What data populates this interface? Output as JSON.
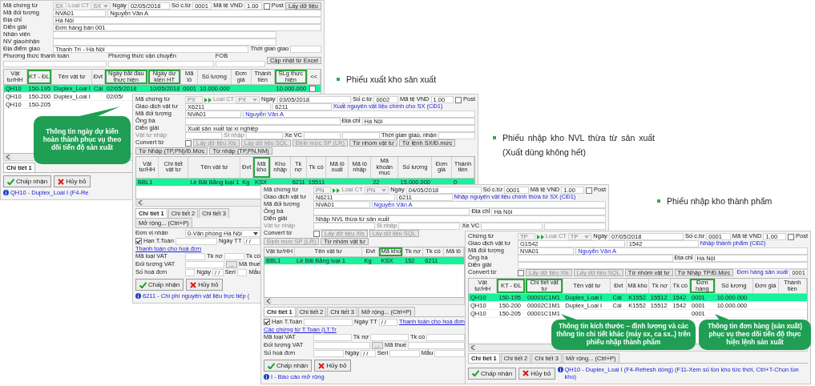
{
  "windows": [
    {
      "form": [
        [
          {
            "kind": "label",
            "text": "Mã chứng từ",
            "disabled": false
          },
          {
            "kind": "field",
            "value": "SX",
            "disabled": true
          },
          {
            "kind": "label",
            "text": "Loại CT",
            "disabled": true
          },
          {
            "kind": "combo",
            "value": "SX",
            "disabled": true
          },
          {
            "kind": "label",
            "text": "Ngày",
            "disabled": false
          },
          {
            "kind": "field",
            "value": "02/05/2018",
            "disabled": false
          },
          {
            "kind": "label",
            "text": "Số c.từ",
            "disabled": false
          },
          {
            "kind": "field",
            "value": "0001",
            "disabled": false
          },
          {
            "kind": "label",
            "text": "Mã tệ",
            "disabled": false
          },
          {
            "kind": "label",
            "text": "VND",
            "disabled": false
          },
          {
            "kind": "field",
            "value": "1.00",
            "disabled": false
          },
          {
            "kind": "check",
            "label": "Post",
            "checked": false
          },
          {
            "kind": "button",
            "label": "Lấy dữ liệu",
            "disabled": false
          }
        ],
        [
          {
            "kind": "label",
            "text": "Mã đối tượng",
            "disabled": false
          },
          {
            "kind": "field",
            "value": "NVA01",
            "disabled": false
          },
          {
            "kind": "field",
            "value": "Nguyễn Văn A",
            "disabled": false
          }
        ],
        [
          {
            "kind": "label",
            "text": "Địa chỉ",
            "disabled": false
          },
          {
            "kind": "field",
            "value": "Hà Nội",
            "disabled": false
          }
        ],
        [
          {
            "kind": "label",
            "text": "Diễn giải",
            "disabled": false
          },
          {
            "kind": "field",
            "value": "Đơn hàng bán 001",
            "disabled": false
          }
        ],
        [
          {
            "kind": "label",
            "text": "Nhân viên",
            "disabled": false
          },
          {
            "kind": "field",
            "disabled": false
          },
          {
            "kind": "spacer"
          }
        ],
        [
          {
            "kind": "label",
            "text": "NV giao/nhận",
            "disabled": false
          },
          {
            "kind": "field",
            "disabled": false
          },
          {
            "kind": "spacer"
          }
        ],
        [
          {
            "kind": "label",
            "text": "Địa điểm giao",
            "disabled": false
          },
          {
            "kind": "field",
            "value": "Thanh Trì - Hà Nội",
            "disabled": false
          },
          {
            "kind": "label",
            "text": "Thời gian giao",
            "disabled": false
          },
          {
            "kind": "field",
            "disabled": false
          }
        ],
        [
          {
            "kind": "titled",
            "label": "Phương thức thanh toán"
          },
          {
            "kind": "titled",
            "label": "Phương thức vận chuyển"
          },
          {
            "kind": "titled",
            "label": "FOB"
          },
          {
            "kind": "button",
            "label": "Cập nhật từ Excel",
            "disabled": false
          }
        ]
      ],
      "grid": {
        "columns": [
          {
            "label": "Vật tư/HH",
            "highlight": false
          },
          {
            "label": "KT - ĐL",
            "highlight": true
          },
          {
            "label": "Tên vật tư",
            "highlight": false
          },
          {
            "label": "Đvt",
            "highlight": false
          },
          {
            "label": "Ngày bắt đầu thực hiện",
            "highlight": true
          },
          {
            "label": "Ngày dự kiến HT",
            "highlight": true
          },
          {
            "label": "Mã lô",
            "highlight": false
          },
          {
            "label": "Số lượng",
            "highlight": false
          },
          {
            "label": "Đơn giá",
            "highlight": false
          },
          {
            "label": "Thành tiền",
            "highlight": false
          },
          {
            "label": "SLg thực hiện",
            "highlight": true
          },
          {
            "label": "<<",
            "highlight": false
          }
        ],
        "rows": [
          {
            "selected": true,
            "cells": [
              "QH10",
              "150-195",
              "Duplex_Loai I",
              "Cái",
              "02/05/2018",
              "10/05/2018",
              "0001",
              "10.000.000",
              null,
              null,
              "10.000.000",
              {
                "checked": false
              }
            ]
          },
          {
            "selected": false,
            "cells": [
              "QH10",
              "150-200",
              "Duplex_Loai I",
              null,
              "02/05/"
            ]
          },
          {
            "selected": false,
            "cells": [
              "QH10",
              "150-205"
            ]
          }
        ]
      },
      "tabs": [
        {
          "label": "Chi tiết 1",
          "selected": true
        }
      ],
      "actions": [
        {
          "kind": "accept",
          "label": "Chấp nhận"
        },
        {
          "kind": "cancel",
          "label": "Hủy bỏ"
        }
      ],
      "status": "QH10 - Duplex_Loai I (F4-Re"
    },
    {
      "form": [
        [
          {
            "kind": "label",
            "text": "Mã chứng từ",
            "disabled": false
          },
          {
            "kind": "field",
            "value": "PX",
            "disabled": true
          },
          {
            "kind": "jump"
          },
          {
            "kind": "label",
            "text": "Loại CT",
            "disabled": true
          },
          {
            "kind": "combo",
            "value": "PX",
            "disabled": true
          },
          {
            "kind": "label",
            "text": "Ngày",
            "disabled": false
          },
          {
            "kind": "field",
            "value": "03/05/2018",
            "disabled": false
          },
          {
            "kind": "label",
            "text": "Số c.từ",
            "disabled": false
          },
          {
            "kind": "field",
            "value": "0002",
            "disabled": false
          },
          {
            "kind": "label",
            "text": "Mã tệ",
            "disabled": false
          },
          {
            "kind": "label",
            "text": "VND",
            "disabled": false
          },
          {
            "kind": "field",
            "value": "1.00",
            "disabled": false
          },
          {
            "kind": "check",
            "label": "Post",
            "checked": false
          }
        ],
        [
          {
            "kind": "label",
            "text": "Giao dịch vật tư",
            "disabled": false
          },
          {
            "kind": "field",
            "value": "X6211",
            "disabled": false
          },
          {
            "kind": "field",
            "value": "6211",
            "disabled": false
          },
          {
            "kind": "link",
            "text": "Xuất nguyên vật liệu chính cho SX (CĐ1)"
          },
          {
            "kind": "spacer"
          }
        ],
        [
          {
            "kind": "label",
            "text": "Mã đối tượng",
            "disabled": false
          },
          {
            "kind": "field",
            "value": "NVA01",
            "disabled": false
          },
          {
            "kind": "name",
            "value": "Nguyễn Văn A"
          }
        ],
        [
          {
            "kind": "label",
            "text": "Ông bà",
            "disabled": false
          },
          {
            "kind": "field",
            "disabled": false
          },
          {
            "kind": "label",
            "text": "Địa chỉ",
            "disabled": false
          },
          {
            "kind": "field",
            "value": "Hà Nội",
            "disabled": false
          }
        ],
        [
          {
            "kind": "label",
            "text": "Diễn giải",
            "disabled": false
          },
          {
            "kind": "field",
            "value": "Xuất sản xuất tại xí nghiệp",
            "disabled": false
          }
        ],
        [
          {
            "kind": "label",
            "text": "Vật tư nhập",
            "disabled": true
          },
          {
            "kind": "field",
            "disabled": false
          },
          {
            "kind": "label",
            "text": "Sl nhập",
            "disabled": true
          },
          {
            "kind": "field",
            "disabled": false
          },
          {
            "kind": "label",
            "text": "Xe VC",
            "disabled": false
          },
          {
            "kind": "field",
            "disabled": false
          },
          {
            "kind": "field",
            "disabled": false
          },
          {
            "kind": "label",
            "text": "Thời gian giao, nhận",
            "disabled": false
          },
          {
            "kind": "field",
            "disabled": false
          }
        ],
        [
          {
            "kind": "label",
            "text": "Convert từ",
            "disabled": false
          },
          {
            "kind": "check",
            "checked": false
          },
          {
            "kind": "button",
            "label": "Lấy dữ liệu Xls",
            "disabled": true
          },
          {
            "kind": "button",
            "label": "Lấy dữ liệu SQL",
            "disabled": true
          },
          {
            "kind": "button",
            "label": "Định mức SP (LR)",
            "disabled": true
          },
          {
            "kind": "button",
            "label": "Từ nhóm vật tư",
            "disabled": false
          },
          {
            "kind": "button",
            "label": "Từ lệnh SX/Đ.mức",
            "disabled": false
          },
          {
            "kind": "button",
            "label": "Từ Nhập (TP,PN)/Đ.Mức",
            "disabled": false
          },
          {
            "kind": "button",
            "label": "Từ nhập (TP,PN,NM)",
            "disabled": false
          }
        ]
      ],
      "grid": {
        "columns": [
          {
            "label": "Vật tư/HH",
            "highlight": false
          },
          {
            "label": "Chi tiết vật tư",
            "highlight": false
          },
          {
            "label": "Tên vật tư",
            "highlight": false
          },
          {
            "label": "Đvt",
            "highlight": false
          },
          {
            "label": "Mã kho",
            "highlight": true
          },
          {
            "label": "Kho nhập",
            "highlight": false
          },
          {
            "label": "Tk nợ",
            "highlight": false
          },
          {
            "label": "Tk có",
            "highlight": false
          },
          {
            "label": "Mã lô xuất",
            "highlight": false
          },
          {
            "label": "Mã lô nhập",
            "highlight": false
          },
          {
            "label": "Mã khoản mục",
            "highlight": false
          },
          {
            "label": "Số lượng",
            "highlight": false
          },
          {
            "label": "Đơn giá",
            "highlight": false
          },
          {
            "label": "Thành tiền",
            "highlight": false
          }
        ],
        "rows": [
          {
            "selected": true,
            "cells": [
              "BBL1",
              null,
              "Lề Bãi Bằng loại 1",
              "Kg",
              "KSX",
              null,
              "6211",
              "15511",
              null,
              null,
              "22",
              "15.000.000",
              null,
              "0"
            ]
          }
        ]
      },
      "tabs": [
        {
          "label": "Chi tiết 1",
          "selected": true
        },
        {
          "label": "Chi tiết 2",
          "selected": false
        },
        {
          "label": "Chi tiết 3",
          "selected": false
        },
        {
          "label": "Mở rộng... (Ctrl+P)",
          "selected": false
        }
      ],
      "details": [
        [
          {
            "kind": "label",
            "text": "Đơn vị nhận",
            "disabled": false
          },
          {
            "kind": "combo",
            "value": "0-Văn phòng Hà Nội",
            "disabled": false
          }
        ],
        [
          {
            "kind": "check",
            "label": "Hạn T.Toán",
            "checked": true
          },
          {
            "kind": "field",
            "disabled": false
          },
          {
            "kind": "label",
            "text": "Ngày TT",
            "disabled": false
          },
          {
            "kind": "field",
            "value": "/ /",
            "disabled": false
          },
          {
            "kind": "link",
            "text": "Thanh toán cho hoá đơn"
          }
        ],
        [
          {
            "kind": "label",
            "text": "Mã loại VAT",
            "disabled": false
          },
          {
            "kind": "field",
            "disabled": false
          },
          {
            "kind": "label",
            "text": "Tk nợ",
            "disabled": false
          },
          {
            "kind": "field",
            "disabled": false
          },
          {
            "kind": "label",
            "text": "Tk có",
            "disabled": false
          }
        ],
        [
          {
            "kind": "label",
            "text": "Đối tượng VAT",
            "disabled": false
          },
          {
            "kind": "field",
            "disabled": false
          },
          {
            "kind": "button",
            "label": "...",
            "disabled": false
          },
          {
            "kind": "label",
            "text": "Mã thuế",
            "disabled": false
          }
        ],
        [
          {
            "kind": "label",
            "text": "Số hoá đơn",
            "disabled": false
          },
          {
            "kind": "field",
            "disabled": false
          },
          {
            "kind": "label",
            "text": "Ngày",
            "disabled": false
          },
          {
            "kind": "field",
            "value": "/ /",
            "disabled": false
          },
          {
            "kind": "label",
            "text": "Seri",
            "disabled": false
          },
          {
            "kind": "field",
            "disabled": false
          },
          {
            "kind": "label",
            "text": "Mẫu",
            "disabled": false
          }
        ]
      ],
      "actions": [
        {
          "kind": "accept",
          "label": "Chấp nhận"
        },
        {
          "kind": "cancel",
          "label": "Hủy bỏ"
        }
      ],
      "status": "6211 - Chi phí nguyên vật liệu trực tiếp ("
    },
    {
      "form": [
        [
          {
            "kind": "label",
            "text": "Mã chứng từ",
            "disabled": false
          },
          {
            "kind": "field",
            "value": "PN",
            "disabled": true
          },
          {
            "kind": "jump"
          },
          {
            "kind": "label",
            "text": "Loại CT",
            "disabled": true
          },
          {
            "kind": "combo",
            "value": "PN",
            "disabled": true
          },
          {
            "kind": "label",
            "text": "Ngày",
            "disabled": false
          },
          {
            "kind": "field",
            "value": "04/05/2018",
            "disabled": false
          },
          {
            "kind": "label",
            "text": "Số c.từ",
            "disabled": false
          },
          {
            "kind": "field",
            "value": "0001",
            "disabled": false
          },
          {
            "kind": "label",
            "text": "Mã tệ",
            "disabled": false
          },
          {
            "kind": "label",
            "text": "VND",
            "disabled": false
          },
          {
            "kind": "field",
            "value": "1.00",
            "disabled": false
          },
          {
            "kind": "check",
            "label": "Post",
            "checked": false
          }
        ],
        [
          {
            "kind": "label",
            "text": "Giao dịch vật tư",
            "disabled": false
          },
          {
            "kind": "field",
            "value": "N6211",
            "disabled": false
          },
          {
            "kind": "field",
            "value": "6211",
            "disabled": false
          },
          {
            "kind": "link",
            "text": "Nhập nguyên vật liệu chính thừa từ SX (CĐ1)"
          },
          {
            "kind": "spacer"
          }
        ],
        [
          {
            "kind": "label",
            "text": "Mã đối tượng",
            "disabled": false
          },
          {
            "kind": "field",
            "value": "NVA01",
            "disabled": false
          },
          {
            "kind": "name",
            "value": "Nguyễn Văn A"
          }
        ],
        [
          {
            "kind": "label",
            "text": "Ông bà",
            "disabled": false
          },
          {
            "kind": "field",
            "disabled": false
          },
          {
            "kind": "label",
            "text": "Địa chỉ",
            "disabled": false
          },
          {
            "kind": "field",
            "value": "Hà Nội",
            "disabled": false
          }
        ],
        [
          {
            "kind": "label",
            "text": "Diễn giải",
            "disabled": false
          },
          {
            "kind": "field",
            "value": "Nhập NVL thừa từ sản xuất",
            "disabled": false
          }
        ],
        [
          {
            "kind": "label",
            "text": "Vật tư nhập",
            "disabled": true
          },
          {
            "kind": "field",
            "disabled": false
          },
          {
            "kind": "label",
            "text": "Sl nhập",
            "disabled": true
          },
          {
            "kind": "field",
            "disabled": false
          },
          {
            "kind": "label",
            "text": "Xe VC",
            "disabled": false
          },
          {
            "kind": "field",
            "disabled": false
          },
          {
            "kind": "field",
            "disabled": false
          }
        ],
        [
          {
            "kind": "label",
            "text": "Convert từ",
            "disabled": false
          },
          {
            "kind": "check",
            "checked": false
          },
          {
            "kind": "button",
            "label": "Lấy dữ liệu Xls",
            "disabled": true
          },
          {
            "kind": "button",
            "label": "Lấy dữ liệu SQL",
            "disabled": true
          },
          {
            "kind": "button",
            "label": "Định mức SP (LR)",
            "disabled": true
          },
          {
            "kind": "button",
            "label": "Từ nhóm vật tư",
            "disabled": false
          }
        ]
      ],
      "grid": {
        "columns": [
          {
            "label": "Vật tư/HH",
            "highlight": false
          },
          {
            "label": "Tên vật tư",
            "highlight": false
          },
          {
            "label": "Đvt",
            "highlight": false
          },
          {
            "label": "Mã kho",
            "highlight": true
          },
          {
            "label": "Tk nợ",
            "highlight": false
          },
          {
            "label": "Tk có",
            "highlight": false
          },
          {
            "label": "Mã lô",
            "highlight": false
          }
        ],
        "rows": [
          {
            "selected": true,
            "cells": [
              "BBL1",
              "Lề Bãi Bằng loại 1",
              "Kg",
              "KSX",
              "152",
              "6211",
              null
            ]
          }
        ]
      },
      "tabs": [
        {
          "label": "Chi tiết 1",
          "selected": true
        },
        {
          "label": "Chi tiết 2",
          "selected": false
        },
        {
          "label": "Chi tiết 3",
          "selected": false
        },
        {
          "label": "Mở rộng... (Ctrl+P)",
          "selected": false
        }
      ],
      "details": [
        [
          {
            "kind": "check",
            "label": "Hạn T.Toán",
            "checked": true
          },
          {
            "kind": "field",
            "disabled": false
          },
          {
            "kind": "label",
            "text": "Ngày TT",
            "disabled": false
          },
          {
            "kind": "field",
            "value": "/ /",
            "disabled": false
          },
          {
            "kind": "link",
            "text": "Thanh toán cho hoá đơn"
          },
          {
            "kind": "link",
            "text": "Các chứng từ T.Toán (LT.Tr"
          }
        ],
        [
          {
            "kind": "label",
            "text": "Mã loại VAT",
            "disabled": false
          },
          {
            "kind": "field",
            "disabled": false
          },
          {
            "kind": "label",
            "text": "Tk nợ",
            "disabled": false
          },
          {
            "kind": "field",
            "disabled": false
          },
          {
            "kind": "label",
            "text": "Tk có",
            "disabled": false
          },
          {
            "kind": "field",
            "disabled": false
          }
        ],
        [
          {
            "kind": "label",
            "text": "Đối tượng VAT",
            "disabled": false
          },
          {
            "kind": "field",
            "disabled": false
          },
          {
            "kind": "button",
            "label": "...",
            "disabled": false
          },
          {
            "kind": "label",
            "text": "Mã thuế",
            "disabled": false
          },
          {
            "kind": "field",
            "disabled": false
          }
        ],
        [
          {
            "kind": "label",
            "text": "Số hoá đơn",
            "disabled": false
          },
          {
            "kind": "field",
            "disabled": false
          },
          {
            "kind": "label",
            "text": "Ngày",
            "disabled": false
          },
          {
            "kind": "field",
            "value": "/ /",
            "disabled": false
          },
          {
            "kind": "label",
            "text": "Seri",
            "disabled": false
          },
          {
            "kind": "field",
            "disabled": false
          },
          {
            "kind": "label",
            "text": "Mẫu",
            "disabled": false
          },
          {
            "kind": "field",
            "disabled": false
          }
        ]
      ],
      "actions": [
        {
          "kind": "accept",
          "label": "Chấp nhận"
        },
        {
          "kind": "cancel",
          "label": "Hủy bỏ"
        }
      ],
      "status": "I - Báo cáo mở rộng"
    },
    {
      "form": [
        [
          {
            "kind": "label",
            "text": "Chứng từ",
            "disabled": false
          },
          {
            "kind": "field",
            "value": "TP",
            "disabled": true
          },
          {
            "kind": "jump"
          },
          {
            "kind": "label",
            "text": "Loại CT",
            "disabled": true
          },
          {
            "kind": "combo",
            "value": "TP",
            "disabled": true
          },
          {
            "kind": "label",
            "text": "Ngày",
            "disabled": false
          },
          {
            "kind": "field",
            "value": "07/05/2018",
            "disabled": false
          },
          {
            "kind": "label",
            "text": "Số c.từ",
            "disabled": false
          },
          {
            "kind": "field",
            "value": "0001",
            "disabled": false
          },
          {
            "kind": "label",
            "text": "Mã tệ",
            "disabled": false
          },
          {
            "kind": "label",
            "text": "VND",
            "disabled": false
          },
          {
            "kind": "field",
            "value": "1.00",
            "disabled": false
          },
          {
            "kind": "check",
            "label": "Post",
            "checked": false
          }
        ],
        [
          {
            "kind": "label",
            "text": "Giao dịch vật tư",
            "disabled": false
          },
          {
            "kind": "field",
            "value": "G1542",
            "disabled": false
          },
          {
            "kind": "field",
            "value": "1542",
            "disabled": false
          },
          {
            "kind": "link",
            "text": "Nhập thành phẩm (CĐ2)"
          },
          {
            "kind": "spacer"
          }
        ],
        [
          {
            "kind": "label",
            "text": "Mã đối tượng",
            "disabled": false
          },
          {
            "kind": "field",
            "value": "NVA01",
            "disabled": false
          },
          {
            "kind": "name",
            "value": "Nguyễn Văn A"
          }
        ],
        [
          {
            "kind": "label",
            "text": "Ông bà",
            "disabled": false
          },
          {
            "kind": "field",
            "disabled": false
          },
          {
            "kind": "label",
            "text": "Địa chỉ",
            "disabled": false
          },
          {
            "kind": "field",
            "value": "Hà Nội",
            "disabled": false
          }
        ],
        [
          {
            "kind": "label",
            "text": "Diễn giải",
            "disabled": false
          },
          {
            "kind": "field",
            "disabled": false
          }
        ],
        [
          {
            "kind": "label",
            "text": "Convert từ",
            "disabled": false
          },
          {
            "kind": "check",
            "checked": false
          },
          {
            "kind": "button",
            "label": "Lấy dữ liệu Xls",
            "disabled": true
          },
          {
            "kind": "button",
            "label": "Lấy dữ liệu SQL",
            "disabled": true
          },
          {
            "kind": "button",
            "label": "Từ nhóm vật tư",
            "disabled": false
          },
          {
            "kind": "button",
            "label": "Từ Nhập TP/Đ.Mức",
            "disabled": false
          },
          {
            "kind": "spacer"
          },
          {
            "kind": "link",
            "text": "Đơn hàng sản xuất"
          },
          {
            "kind": "field",
            "value": "0001",
            "disabled": false
          }
        ]
      ],
      "grid": {
        "columns": [
          {
            "label": "Vật tư/HH",
            "highlight": false
          },
          {
            "label": "KT - ĐL",
            "highlight": true
          },
          {
            "label": "Chi tiết vật tư",
            "highlight": true
          },
          {
            "label": "Tên vật tư",
            "highlight": false
          },
          {
            "label": "Đvt",
            "highlight": false
          },
          {
            "label": "Mã kho",
            "highlight": false
          },
          {
            "label": "Tk nợ",
            "highlight": false
          },
          {
            "label": "Tk có",
            "highlight": false
          },
          {
            "label": "Đơn hàng",
            "highlight": true
          },
          {
            "label": "Số lượng",
            "highlight": false
          },
          {
            "label": "Đơn giá",
            "highlight": false
          },
          {
            "label": "Thành tiền",
            "highlight": false
          }
        ],
        "rows": [
          {
            "selected": true,
            "cells": [
              "QH10",
              "150-195",
              "00001C1M1",
              "Duplex_Loai I",
              "Cái",
              "K1552",
              "15512",
              "1542",
              "0001",
              "10.000.000",
              null,
              null
            ]
          },
          {
            "selected": false,
            "cells": [
              "QH10",
              "150-200",
              "00002C1M1",
              "Duplex_Loai I",
              "Cái",
              "K1552",
              "15512",
              "1542",
              "0001",
              "10.000.000",
              null,
              null
            ]
          },
          {
            "selected": false,
            "cells": [
              "QH10",
              "150-205",
              "00001C1M1",
              null,
              null,
              null,
              null,
              null,
              "0001",
              null,
              null,
              null
            ]
          }
        ]
      },
      "tabs": [
        {
          "label": "Chi tiết 1",
          "selected": true
        },
        {
          "label": "Chi tiết 2",
          "selected": false
        },
        {
          "label": "Chi tiết 3",
          "selected": false
        },
        {
          "label": "Mở rộng... (Ctrl+P)",
          "selected": false
        }
      ],
      "actions": [
        {
          "kind": "accept",
          "label": "Chấp nhận"
        },
        {
          "kind": "cancel",
          "label": "Hủy bỏ"
        }
      ],
      "status": "QH10 - Duplex_Loai I  (F4-Refresh dòng)  (F11-Xem số tồn kho tức thời, Ctrl+T-Chọn tồn kho)"
    }
  ],
  "captions": [
    "Phiếu xuất kho sản xuất",
    "Phiếu nhập kho NVL thừa từ sản xuất (Xuất dùng không hết)",
    "Phiếu nhập kho thành phẩm"
  ],
  "callouts": [
    "Thông tin ngày dự kiến hoàn thành phục vụ theo dõi tiến độ sản xuất",
    "Thông tin kích thước – định lượng và các thông tin chi tiết khác (máy sx, ca sx..) trên phiếu nhập thành phẩm",
    "Thông tin đơn hàng (sản xuất) phục vụ theo dõi tiến độ thực hiện lệnh sản xuất"
  ]
}
